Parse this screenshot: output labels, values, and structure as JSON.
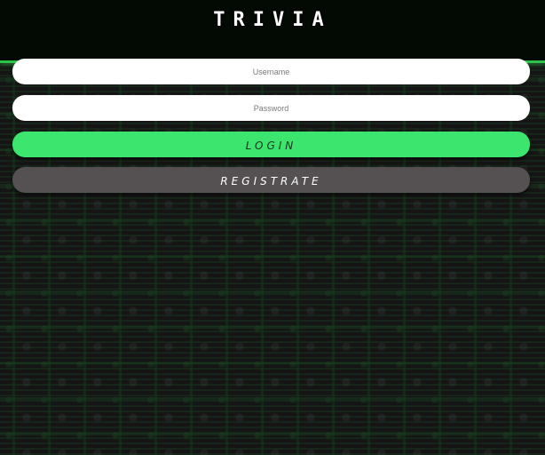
{
  "header": {
    "title": "TRIVIA"
  },
  "login_form": {
    "username_placeholder": "Username",
    "password_placeholder": "Password",
    "login_label": "LOGIN",
    "register_label": "REGISTRATE"
  },
  "colors": {
    "accent": "#3be56e",
    "header_bg": "#030a04",
    "register_bg": "#555051"
  }
}
